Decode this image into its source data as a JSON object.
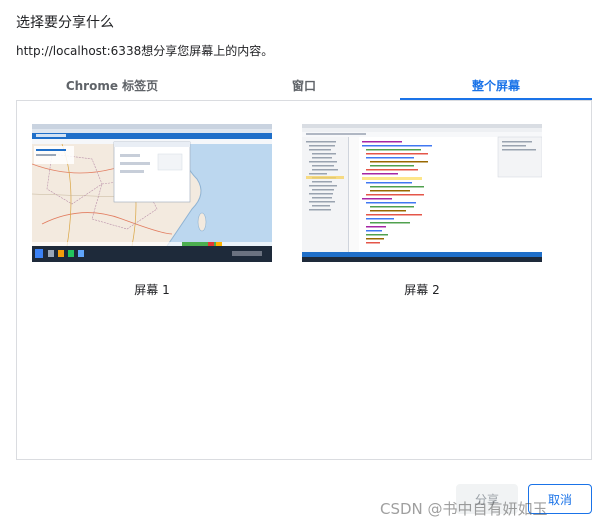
{
  "dialog": {
    "title": "选择要分享什么",
    "subtitle": "http://localhost:6338想分享您屏幕上的内容。"
  },
  "tabs": [
    {
      "label": "Chrome 标签页",
      "active": false
    },
    {
      "label": "窗口",
      "active": false
    },
    {
      "label": "整个屏幕",
      "active": true
    }
  ],
  "screens": [
    {
      "label": "屏幕 1",
      "preview": "map-desktop-preview"
    },
    {
      "label": "屏幕 2",
      "preview": "code-editor-preview"
    }
  ],
  "buttons": {
    "share_label": "分享",
    "cancel_label": "取消"
  },
  "watermark": "CSDN @书中自有妍如玉",
  "colors": {
    "accent": "#1a73e8",
    "border": "#dadce0",
    "disabled_bg": "#f1f3f4"
  }
}
